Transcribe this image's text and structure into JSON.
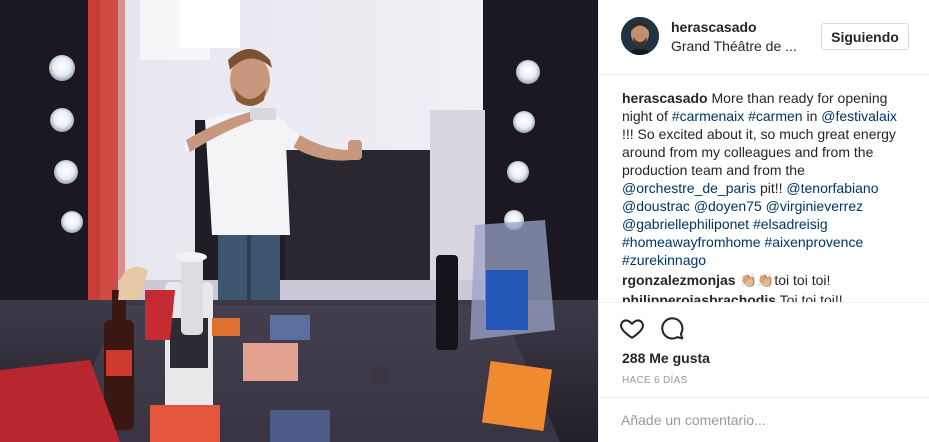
{
  "post": {
    "username": "herascasado",
    "location": "Grand Théâtre de ...",
    "follow_label": "Siguiendo",
    "caption_parts": [
      {
        "t": "u",
        "v": "herascasado"
      },
      {
        "t": "x",
        "v": " More than ready for opening night of "
      },
      {
        "t": "h",
        "v": "#carmenaix"
      },
      {
        "t": "x",
        "v": " "
      },
      {
        "t": "h",
        "v": "#carmen"
      },
      {
        "t": "x",
        "v": " in "
      },
      {
        "t": "h",
        "v": "@festivalaix"
      },
      {
        "t": "x",
        "v": " !!! So excited about it, so much great energy around from my colleagues and from the production team and from the "
      },
      {
        "t": "h",
        "v": "@orchestre_de_paris"
      },
      {
        "t": "x",
        "v": " pit!! "
      },
      {
        "t": "h",
        "v": "@tenorfabiano"
      },
      {
        "t": "x",
        "v": " "
      },
      {
        "t": "h",
        "v": "@doustrac"
      },
      {
        "t": "x",
        "v": " "
      },
      {
        "t": "h",
        "v": "@doyen75"
      },
      {
        "t": "x",
        "v": " "
      },
      {
        "t": "h",
        "v": "@virginieverrez"
      },
      {
        "t": "x",
        "v": " "
      },
      {
        "t": "h",
        "v": "@gabriellephiliponet"
      },
      {
        "t": "x",
        "v": " "
      },
      {
        "t": "h",
        "v": "#elsadreisig"
      },
      {
        "t": "x",
        "v": " "
      },
      {
        "t": "h",
        "v": "#homeawayfromhome"
      },
      {
        "t": "x",
        "v": " "
      },
      {
        "t": "h",
        "v": "#aixenprovence"
      },
      {
        "t": "x",
        "v": " "
      },
      {
        "t": "h",
        "v": "#zurekinnago"
      }
    ],
    "comments": [
      {
        "user": "rgonzalezmonjas",
        "text": " 👏🏼👏🏼toi toi toi!"
      },
      {
        "user": "philipperojasbrachodis",
        "text": " Toi toi toi!!"
      }
    ],
    "likes": "288 Me gusta",
    "time": "HACE 6 DÍAS",
    "comment_placeholder": "Añade un comentario...",
    "icons": {
      "like": "heart-icon",
      "comment": "speech-bubble-icon"
    },
    "colors": {
      "link": "#003569",
      "muted": "#999999",
      "border": "#efefef"
    }
  }
}
